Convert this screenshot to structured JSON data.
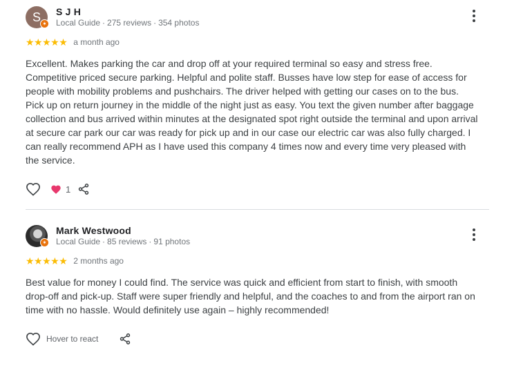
{
  "reviews": [
    {
      "avatar_letter": "S",
      "name": "S J H",
      "meta": {
        "type": "Local Guide",
        "reviews": "275 reviews",
        "photos": "354 photos"
      },
      "stars": "★★★★★",
      "rating": 5,
      "time": "a month ago",
      "text": "Excellent. Makes parking the car and drop off at your required terminal so easy and stress free.\nCompetitive priced secure parking. Helpful and polite staff. Busses have low step for ease of access for\npeople with mobility problems and pushchairs. The driver helped with getting our cases on to the bus.\nPick up on return journey in the middle of the night just as easy. You text the given number after baggage\ncollection and bus arrived within minutes at the designated spot right outside the terminal and upon arrival\nat secure car park our car was ready for pick up and in our case our electric car was also fully charged. I\ncan really recommend APH as I have used this company 4 times now and every time very pleased with\nthe service.",
      "reaction_count": "1"
    },
    {
      "name": "Mark Westwood",
      "meta": {
        "type": "Local Guide",
        "reviews": "85 reviews",
        "photos": "91 photos"
      },
      "stars": "★★★★★",
      "rating": 5,
      "time": "2 months ago",
      "text": "Best value for money I could find. The service was quick and efficient from start to finish, with smooth\ndrop-off and pick-up. Staff were super friendly and helpful, and the coaches to and from the airport ran on\ntime with no hassle. Would definitely use again – highly recommended!",
      "hover_label": "Hover to react"
    }
  ],
  "colors": {
    "star": "#fbbc04",
    "heart_reaction": "#e8386d",
    "badge": "#e8710a",
    "divider": "#dadce0"
  }
}
